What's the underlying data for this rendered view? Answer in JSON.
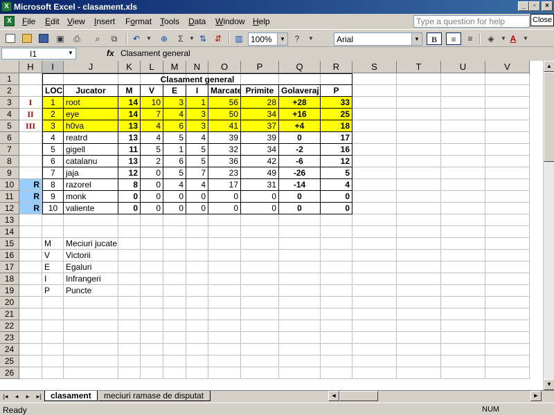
{
  "window": {
    "title": "Microsoft Excel - clasament.xls",
    "close_label": "Close"
  },
  "menu": {
    "items": [
      "File",
      "Edit",
      "View",
      "Insert",
      "Format",
      "Tools",
      "Data",
      "Window",
      "Help"
    ],
    "help_placeholder": "Type a question for help"
  },
  "toolbar": {
    "zoom": "100%",
    "font": "Arial",
    "bold_label": "B"
  },
  "formula_bar": {
    "name_box": "I1",
    "fx": "fx",
    "content": "Clasament general"
  },
  "columns": [
    "H",
    "I",
    "J",
    "K",
    "L",
    "M",
    "N",
    "O",
    "P",
    "Q",
    "R",
    "S",
    "T",
    "U",
    "V"
  ],
  "rows": [
    "1",
    "2",
    "3",
    "4",
    "5",
    "6",
    "7",
    "8",
    "9",
    "10",
    "11",
    "12",
    "13",
    "14",
    "15",
    "16",
    "17",
    "18",
    "19",
    "20",
    "21",
    "22",
    "23",
    "24",
    "25",
    "26"
  ],
  "table": {
    "title": "Clasament general",
    "headers": [
      "LOC",
      "Jucator",
      "M",
      "V",
      "E",
      "I",
      "Marcate",
      "Primite",
      "Golaveraj",
      "P"
    ],
    "rows": [
      {
        "rank": "I",
        "loc": "1",
        "player": "root",
        "m": "14",
        "v": "10",
        "e": "3",
        "i": "1",
        "marcate": "56",
        "primite": "28",
        "gol": "+28",
        "p": "33"
      },
      {
        "rank": "II",
        "loc": "2",
        "player": "eye",
        "m": "14",
        "v": "7",
        "e": "4",
        "i": "3",
        "marcate": "50",
        "primite": "34",
        "gol": "+16",
        "p": "25"
      },
      {
        "rank": "III",
        "loc": "3",
        "player": "h0va",
        "m": "13",
        "v": "4",
        "e": "6",
        "i": "3",
        "marcate": "41",
        "primite": "37",
        "gol": "+4",
        "p": "18"
      },
      {
        "rank": "",
        "loc": "4",
        "player": "reatrd",
        "m": "13",
        "v": "4",
        "e": "5",
        "i": "4",
        "marcate": "39",
        "primite": "39",
        "gol": "0",
        "p": "17"
      },
      {
        "rank": "",
        "loc": "5",
        "player": "gigell",
        "m": "11",
        "v": "5",
        "e": "1",
        "i": "5",
        "marcate": "32",
        "primite": "34",
        "gol": "-2",
        "p": "16"
      },
      {
        "rank": "",
        "loc": "6",
        "player": "catalanu",
        "m": "13",
        "v": "2",
        "e": "6",
        "i": "5",
        "marcate": "36",
        "primite": "42",
        "gol": "-6",
        "p": "12"
      },
      {
        "rank": "",
        "loc": "7",
        "player": "jaja",
        "m": "12",
        "v": "0",
        "e": "5",
        "i": "7",
        "marcate": "23",
        "primite": "49",
        "gol": "-26",
        "p": "5"
      },
      {
        "rank": "R",
        "loc": "8",
        "player": "razorel",
        "m": "8",
        "v": "0",
        "e": "4",
        "i": "4",
        "marcate": "17",
        "primite": "31",
        "gol": "-14",
        "p": "4"
      },
      {
        "rank": "R",
        "loc": "9",
        "player": "monk",
        "m": "0",
        "v": "0",
        "e": "0",
        "i": "0",
        "marcate": "0",
        "primite": "0",
        "gol": "0",
        "p": "0"
      },
      {
        "rank": "R",
        "loc": "10",
        "player": "valiente",
        "m": "0",
        "v": "0",
        "e": "0",
        "i": "0",
        "marcate": "0",
        "primite": "0",
        "gol": "0",
        "p": "0"
      }
    ]
  },
  "legend": [
    {
      "key": "M",
      "text": "Meciuri jucate"
    },
    {
      "key": "V",
      "text": "Victorii"
    },
    {
      "key": "E",
      "text": "Egaluri"
    },
    {
      "key": "I",
      "text": "Infrangeri"
    },
    {
      "key": "P",
      "text": "Puncte"
    }
  ],
  "sheets": [
    "clasament",
    "meciuri ramase de disputat"
  ],
  "status": {
    "text": "Ready",
    "num": "NUM"
  },
  "colors": {
    "highlight": "#ffff00",
    "relegation": "#99ccff",
    "rank_text": "#c00000"
  }
}
